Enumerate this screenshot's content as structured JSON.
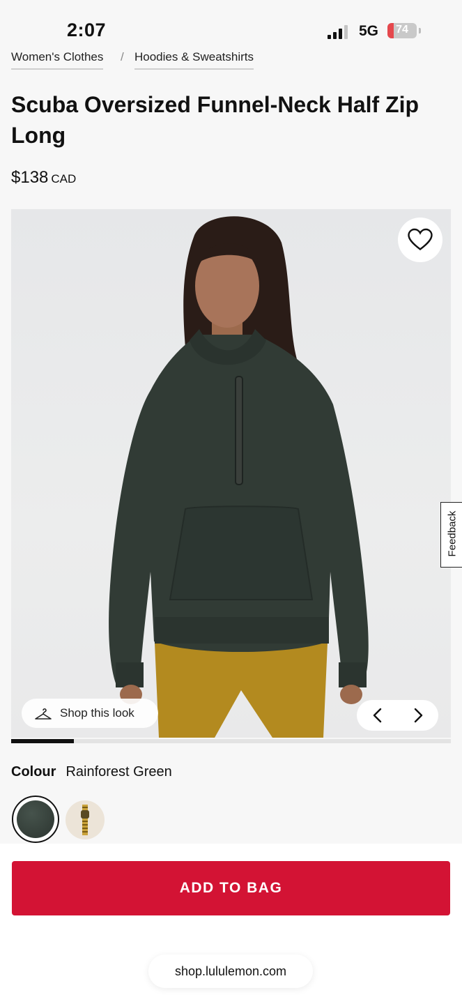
{
  "status_bar": {
    "time": "2:07",
    "network": "5G",
    "battery": "74"
  },
  "breadcrumb": [
    {
      "label": "Women's Clothes"
    },
    {
      "label": "Hoodies & Sweatshirts"
    }
  ],
  "breadcrumb_separator": "/",
  "product": {
    "title": "Scuba Oversized Funnel-Neck Half Zip Long",
    "price": "$138",
    "currency": "CAD"
  },
  "gallery": {
    "shop_this_look": "Shop this look",
    "feedback": "Feedback",
    "image_index": 1,
    "progress_fraction": 0.143
  },
  "colour": {
    "label": "Colour",
    "selected": "Rainforest Green",
    "swatch_color": "#2f3833"
  },
  "cta": {
    "add_to_bag": "ADD TO BAG"
  },
  "browser": {
    "url": "shop.lululemon.com"
  },
  "theme": {
    "accent": "#d31334"
  },
  "icons": [
    "heart-icon",
    "hanger-icon",
    "chevron-left-icon",
    "chevron-right-icon",
    "zipper-icon",
    "signal-icon",
    "battery-icon"
  ]
}
